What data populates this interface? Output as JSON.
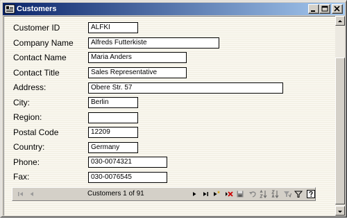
{
  "window": {
    "title": "Customers",
    "controls": {
      "minimize": "minimize-icon",
      "maximize": "maximize-icon",
      "close": "close-icon"
    }
  },
  "form": {
    "fields": [
      {
        "label": "Customer ID",
        "value": "ALFKI"
      },
      {
        "label": "Company Name",
        "value": "Alfreds Futterkiste"
      },
      {
        "label": "Contact Name",
        "value": "Maria Anders"
      },
      {
        "label": "Contact Title",
        "value": "Sales Representative"
      },
      {
        "label": "Address:",
        "value": "Obere Str. 57"
      },
      {
        "label": "City:",
        "value": "Berlin"
      },
      {
        "label": "Region:",
        "value": ""
      },
      {
        "label": "Postal Code",
        "value": "12209"
      },
      {
        "label": "Country:",
        "value": "Germany"
      },
      {
        "label": "Phone:",
        "value": "030-0074321"
      },
      {
        "label": "Fax:",
        "value": "030-0076545"
      }
    ]
  },
  "navigator": {
    "status": "Customers 1 of 91",
    "buttons": [
      "first-record-icon",
      "previous-record-icon",
      "next-record-icon",
      "last-record-icon",
      "add-new-icon",
      "delete-icon",
      "save-icon",
      "undo-icon",
      "sort-ascending-icon",
      "sort-descending-icon",
      "filter-by-selection-icon",
      "filter-icon",
      "help-icon"
    ]
  },
  "colors": {
    "titlebar_start": "#0a246a",
    "titlebar_end": "#a6caf0",
    "window_face": "#d4d0c8",
    "form_background": "#f9f7ef",
    "delete_red": "#cc0000"
  }
}
